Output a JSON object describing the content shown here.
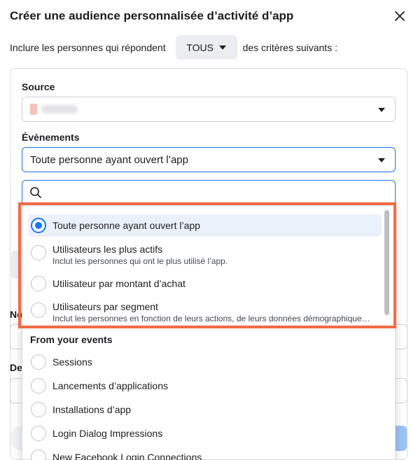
{
  "dialog": {
    "title": "Créer une audience personnalisée d’activité d’app"
  },
  "include": {
    "prefix": "Inclure les personnes qui répondent",
    "selected": "TOUS",
    "suffix": "des critères suivants :"
  },
  "source": {
    "label": "Source"
  },
  "events": {
    "label": "Évènements",
    "selected": "Toute personne ayant ouvert l’app"
  },
  "stubs": {
    "label_1": "No",
    "label_2": "De"
  },
  "dropdown": {
    "options": [
      {
        "label": "Toute personne ayant ouvert l’app",
        "description": "",
        "selected": true
      },
      {
        "label": "Utilisateurs les plus actifs",
        "description": "Inclut les personnes qui ont le plus utilisé l’app.",
        "selected": false
      },
      {
        "label": "Utilisateur par montant d’achat",
        "description": "",
        "selected": false
      },
      {
        "label": "Utilisateurs par segment",
        "description": "Inclut les personnes en fonction de leurs actions, de leurs données démographiques …",
        "selected": false
      }
    ],
    "section_title": "From your events",
    "event_options": [
      {
        "label": "Sessions"
      },
      {
        "label": "Lancements d’applications"
      },
      {
        "label": "Installations d’app"
      },
      {
        "label": "Login Dialog Impressions"
      },
      {
        "label": "New Facebook Login Connections"
      }
    ]
  },
  "colors": {
    "accent": "#1877f2",
    "highlight": "#f26b45"
  }
}
